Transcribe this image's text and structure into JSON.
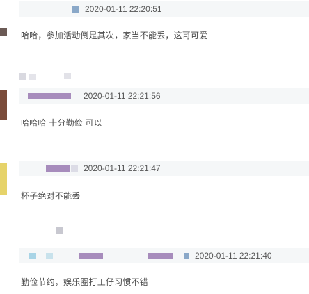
{
  "comments": [
    {
      "timestamp": "2020-01-11 22:20:51",
      "text": "哈哈，参加活动倒是其次，家当不能丢，这哥可爱"
    },
    {
      "timestamp": "2020-01-11 22:21:56",
      "text": "哈哈哈 十分勤俭 可以"
    },
    {
      "timestamp": "2020-01-11 22:21:47",
      "text": "杯子绝对不能丢"
    },
    {
      "timestamp": "2020-01-11 22:21:40",
      "text": "勤俭节约，娱乐圈打工仔习惯不错"
    }
  ]
}
